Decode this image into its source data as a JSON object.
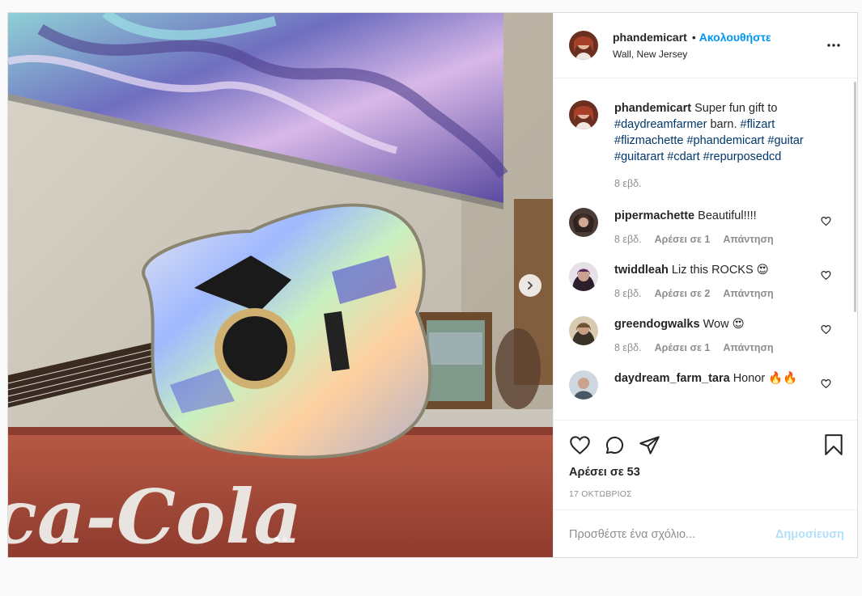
{
  "post": {
    "username": "phandemicart",
    "follow_label": "Ακολουθήστε",
    "bullet": "•",
    "location": "Wall, New Jersey",
    "caption": {
      "username": "phandemicart",
      "text_plain": " Super fun gift to ",
      "tags": [
        "#daydreamfarmer",
        "#flizart",
        "#flizmachette",
        "#phandemicart",
        "#guitar",
        "#guitarart",
        "#cdart",
        "#repurposedcd"
      ],
      "mid_text": " barn. ",
      "age": "8 εβδ."
    },
    "photo_text": "ca-Cola"
  },
  "comments": [
    {
      "username": "pipermachette",
      "text": "Beautiful!!!!",
      "age": "8 εβδ.",
      "likes": "Αρέσει σε 1",
      "reply": "Απάντηση"
    },
    {
      "username": "twiddleah",
      "text": "Liz this ROCKS 😍",
      "age": "8 εβδ.",
      "likes": "Αρέσει σε 2",
      "reply": "Απάντηση"
    },
    {
      "username": "greendogwalks",
      "text": "Wow 😍",
      "age": "8 εβδ.",
      "likes": "Αρέσει σε 1",
      "reply": "Απάντηση"
    },
    {
      "username": "daydream_farm_tara",
      "text": "Honor 🔥🔥"
    }
  ],
  "actions": {
    "likes": "Αρέσει σε 53",
    "date": "17 ΟΚΤΩΒΡΙΟΣ",
    "add_comment_placeholder": "Προσθέστε ένα σχόλιο...",
    "publish_label": "Δημοσίευση"
  },
  "icons": {
    "more": "more-options-icon",
    "like": "heart-icon",
    "comment": "comment-icon",
    "share": "share-icon",
    "save": "bookmark-icon",
    "next": "chevron-right-icon"
  },
  "colors": {
    "accent": "#0095f6",
    "hashtag": "#00376b",
    "muted": "#8e8e8e",
    "publish_disabled": "#b2dffc"
  },
  "carousel": {
    "count": 2,
    "active": 0
  }
}
